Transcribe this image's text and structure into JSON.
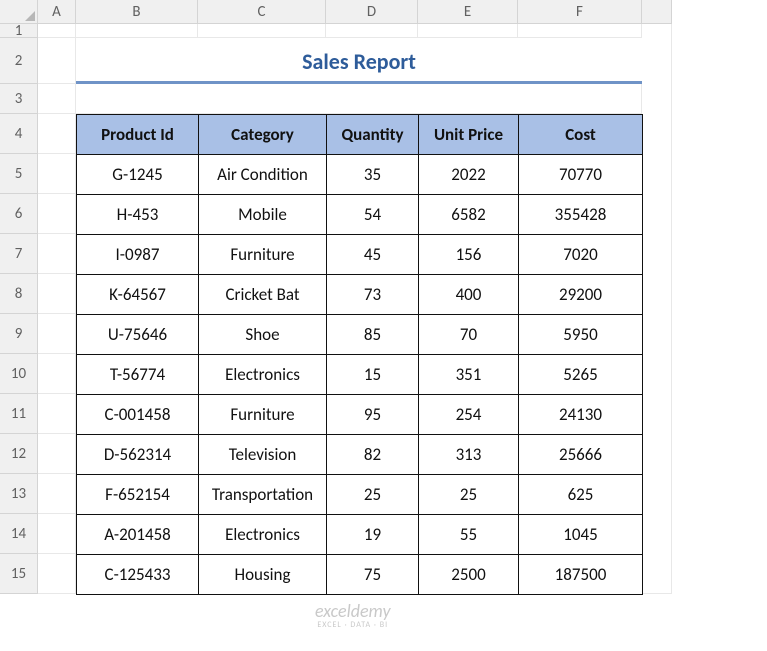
{
  "columns": [
    "A",
    "B",
    "C",
    "D",
    "E",
    "F",
    ""
  ],
  "rows": [
    "1",
    "2",
    "3",
    "4",
    "5",
    "6",
    "7",
    "8",
    "9",
    "10",
    "11",
    "12",
    "13",
    "14",
    "15"
  ],
  "title": "Sales Report",
  "headers": [
    "Product Id",
    "Category",
    "Quantity",
    "Unit Price",
    "Cost"
  ],
  "data": [
    {
      "id": "G-1245",
      "cat": "Air Condition",
      "qty": "35",
      "price": "2022",
      "cost": "70770"
    },
    {
      "id": "H-453",
      "cat": "Mobile",
      "qty": "54",
      "price": "6582",
      "cost": "355428"
    },
    {
      "id": "I-0987",
      "cat": "Furniture",
      "qty": "45",
      "price": "156",
      "cost": "7020"
    },
    {
      "id": "K-64567",
      "cat": "Cricket Bat",
      "qty": "73",
      "price": "400",
      "cost": "29200"
    },
    {
      "id": "U-75646",
      "cat": "Shoe",
      "qty": "85",
      "price": "70",
      "cost": "5950"
    },
    {
      "id": "T-56774",
      "cat": "Electronics",
      "qty": "15",
      "price": "351",
      "cost": "5265"
    },
    {
      "id": "C-001458",
      "cat": "Furniture",
      "qty": "95",
      "price": "254",
      "cost": "24130"
    },
    {
      "id": "D-562314",
      "cat": "Television",
      "qty": "82",
      "price": "313",
      "cost": "25666"
    },
    {
      "id": "F-652154",
      "cat": "Transportation",
      "qty": "25",
      "price": "25",
      "cost": "625"
    },
    {
      "id": "A-201458",
      "cat": "Electronics",
      "qty": "19",
      "price": "55",
      "cost": "1045"
    },
    {
      "id": "C-125433",
      "cat": "Housing",
      "qty": "75",
      "price": "2500",
      "cost": "187500"
    }
  ],
  "watermark": {
    "main": "exceldemy",
    "sub": "EXCEL · DATA · BI"
  },
  "chart_data": {
    "type": "table",
    "title": "Sales Report",
    "columns": [
      "Product Id",
      "Category",
      "Quantity",
      "Unit Price",
      "Cost"
    ],
    "rows": [
      [
        "G-1245",
        "Air Condition",
        35,
        2022,
        70770
      ],
      [
        "H-453",
        "Mobile",
        54,
        6582,
        355428
      ],
      [
        "I-0987",
        "Furniture",
        45,
        156,
        7020
      ],
      [
        "K-64567",
        "Cricket Bat",
        73,
        400,
        29200
      ],
      [
        "U-75646",
        "Shoe",
        85,
        70,
        5950
      ],
      [
        "T-56774",
        "Electronics",
        15,
        351,
        5265
      ],
      [
        "C-001458",
        "Furniture",
        95,
        254,
        24130
      ],
      [
        "D-562314",
        "Television",
        82,
        313,
        25666
      ],
      [
        "F-652154",
        "Transportation",
        25,
        25,
        625
      ],
      [
        "A-201458",
        "Electronics",
        19,
        55,
        1045
      ],
      [
        "C-125433",
        "Housing",
        75,
        2500,
        187500
      ]
    ]
  }
}
